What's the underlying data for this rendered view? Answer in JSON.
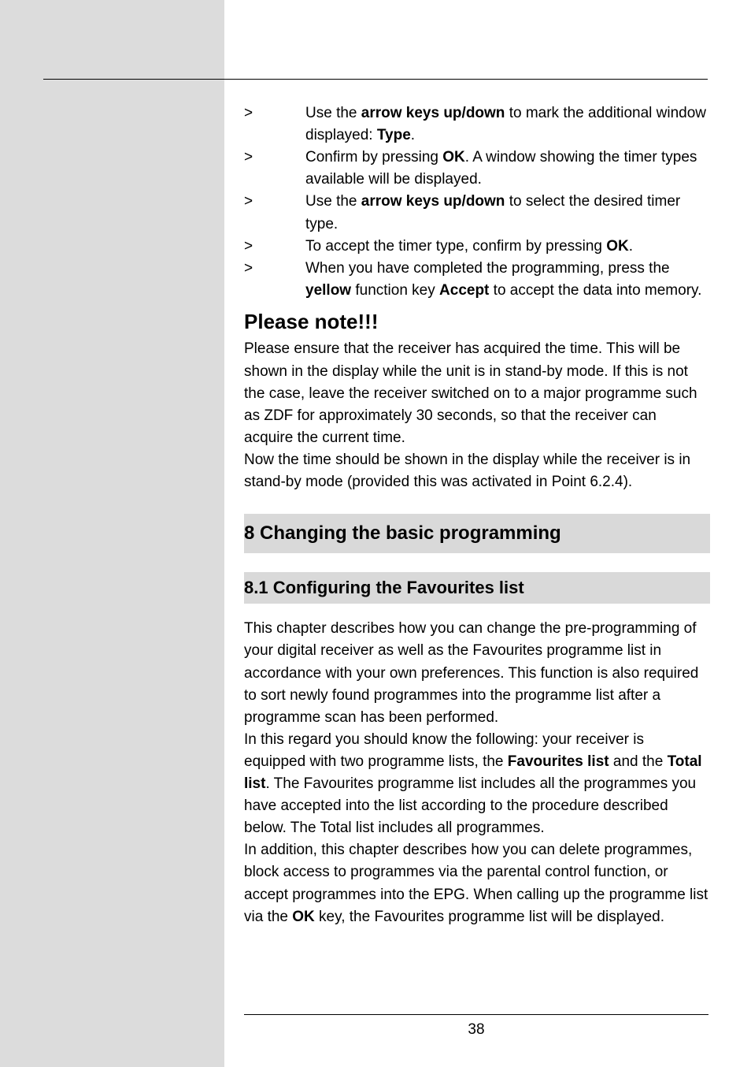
{
  "bullets": [
    {
      "marker": ">",
      "t1": "Use the ",
      "b1": "arrow keys up/down",
      "t2": " to mark the additional window displayed: ",
      "b2": "Type",
      "t3": "."
    },
    {
      "marker": ">",
      "t1": "Confirm by pressing ",
      "b1": "OK",
      "t2": ". A window showing the timer types available will be displayed."
    },
    {
      "marker": ">",
      "t1": "Use the ",
      "b1": "arrow keys up/down",
      "t2": " to select the desired timer type."
    },
    {
      "marker": ">",
      "t1": "To accept the timer type, confirm by pressing  ",
      "b1": "OK",
      "t2": "."
    },
    {
      "marker": ">",
      "t1": "When you have completed the programming, press the ",
      "b1": "yellow",
      "t2": " function key ",
      "b2": "Accept",
      "t3": " to accept the data into memory."
    }
  ],
  "note_heading": "Please note!!!",
  "note_para1": "Please ensure that the receiver has acquired the time. This will be shown in the display while the unit is in stand-by mode. If this is not the case, leave the receiver switched on to a major programme such as ZDF for approximately 30 seconds, so that the receiver can acquire the current time.",
  "note_para2": "Now the time should be shown in the display while the receiver is in stand-by mode (provided this was activated in Point 6.2.4).",
  "section_heading": "8 Changing the basic programming",
  "subsection_heading": "8.1 Configuring the Favourites list",
  "body_para1": "This chapter describes how you can change the pre-programming of your digital receiver as well as the Favourites programme list in accordance with your own preferences. This function is also required to sort newly found programmes into the programme list after a programme scan has been performed.",
  "body_para2": {
    "t1": "In this regard you should know the following: your receiver is equipped with two programme lists, the  ",
    "b1": "Favourites list",
    "t2": " and the ",
    "b2": "Total list",
    "t3": ". The Favourites programme list includes all the programmes you have accepted into the list according to the procedure described below. The Total list includes all programmes."
  },
  "body_para3": {
    "t1": "In addition, this chapter describes how you can delete programmes, block access to programmes via the parental control function, or accept programmes into the EPG. When calling up the programme list via the  ",
    "b1": "OK",
    "t2": " key, the Favourites programme list will be displayed."
  },
  "page_number": "38"
}
